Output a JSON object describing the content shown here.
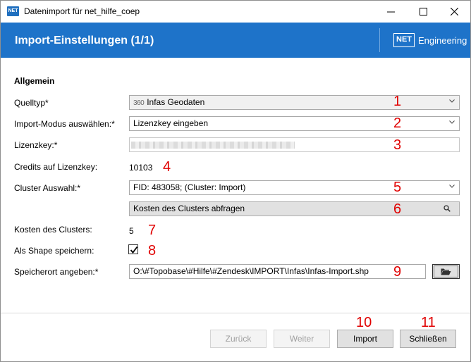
{
  "window": {
    "title": "Datenimport für net_hilfe_coep",
    "app_icon_text": "NET"
  },
  "header": {
    "title": "Import-Einstellungen (1/1)",
    "logo_box": "NET",
    "logo_text": "Engineering"
  },
  "form": {
    "section_title": "Allgemein",
    "quelltyp": {
      "label": "Quelltyp*",
      "icon_text": "360",
      "value": "Infas Geodaten"
    },
    "import_modus": {
      "label": "Import-Modus auswählen:*",
      "value": "Lizenzkey eingeben"
    },
    "lizenzkey": {
      "label": "Lizenzkey:*"
    },
    "credits": {
      "label": "Credits auf Lizenzkey:",
      "value": "10103"
    },
    "cluster": {
      "label": "Cluster Auswahl:*",
      "value": "FID: 483058; (Cluster: Import)"
    },
    "kosten_button": {
      "label": "Kosten des Clusters abfragen"
    },
    "kosten": {
      "label": "Kosten des Clusters:",
      "value": "5"
    },
    "shape": {
      "label": "Als Shape speichern:",
      "checked": true
    },
    "speicherort": {
      "label": "Speicherort angeben:*",
      "value": "O:\\#Topobase\\#Hilfe\\#Zendesk\\IMPORT\\Infas\\Infas-Import.shp"
    }
  },
  "annotations": [
    "1",
    "2",
    "3",
    "4",
    "5",
    "6",
    "7",
    "8",
    "9",
    "10",
    "11"
  ],
  "footer": {
    "back_label": "Zurück",
    "next_label": "Weiter",
    "import_label": "Import",
    "close_label": "Schließen"
  },
  "colors": {
    "banner": "#1e73c9",
    "annotation": "#e00000"
  }
}
